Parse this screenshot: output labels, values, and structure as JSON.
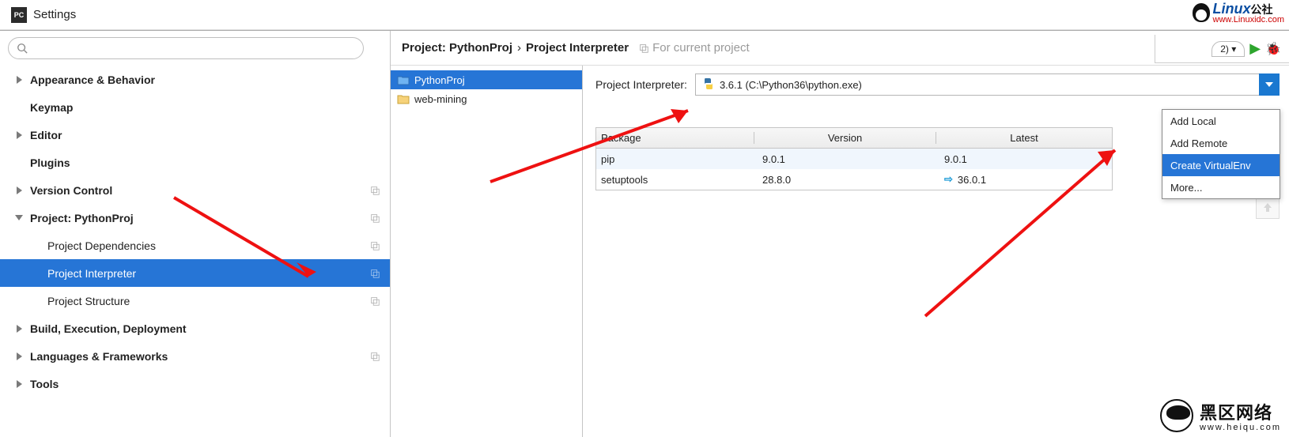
{
  "window": {
    "title": "Settings"
  },
  "search": {
    "placeholder": ""
  },
  "sidebar": {
    "items": [
      {
        "label": "Appearance & Behavior",
        "kind": "group",
        "expanded": false
      },
      {
        "label": "Keymap",
        "kind": "item"
      },
      {
        "label": "Editor",
        "kind": "group",
        "expanded": false
      },
      {
        "label": "Plugins",
        "kind": "item"
      },
      {
        "label": "Version Control",
        "kind": "group",
        "expanded": false,
        "has_scope_icon": true
      },
      {
        "label": "Project: PythonProj",
        "kind": "group",
        "expanded": true,
        "has_scope_icon": true
      },
      {
        "label": "Project Dependencies",
        "kind": "child",
        "has_scope_icon": true
      },
      {
        "label": "Project Interpreter",
        "kind": "child",
        "has_scope_icon": true,
        "selected": true
      },
      {
        "label": "Project Structure",
        "kind": "child",
        "has_scope_icon": true
      },
      {
        "label": "Build, Execution, Deployment",
        "kind": "group",
        "expanded": false
      },
      {
        "label": "Languages & Frameworks",
        "kind": "group",
        "expanded": false,
        "has_scope_icon": true
      },
      {
        "label": "Tools",
        "kind": "group",
        "expanded": false
      }
    ]
  },
  "breadcrumb": {
    "part1": "Project: PythonProj",
    "sep": "›",
    "part2": "Project Interpreter",
    "hint": "For current project"
  },
  "projects": [
    {
      "name": "PythonProj",
      "selected": true
    },
    {
      "name": "web-mining",
      "selected": false
    }
  ],
  "interpreter": {
    "label": "Project Interpreter:",
    "value": "3.6.1 (C:\\Python36\\python.exe)"
  },
  "packages": {
    "columns": [
      "Package",
      "Version",
      "Latest"
    ],
    "rows": [
      {
        "name": "pip",
        "version": "9.0.1",
        "latest": "9.0.1",
        "upgrade": false,
        "selected": true
      },
      {
        "name": "setuptools",
        "version": "28.8.0",
        "latest": "36.0.1",
        "upgrade": true,
        "selected": false
      }
    ]
  },
  "dropdown_menu": {
    "items": [
      {
        "label": "Add Local"
      },
      {
        "label": "Add Remote"
      },
      {
        "label": "Create VirtualEnv",
        "selected": true
      },
      {
        "label": "More..."
      }
    ]
  },
  "toolbar_fragment": {
    "label": "2)"
  },
  "watermarks": {
    "top_brand": "Linux",
    "top_suffix": "公社",
    "top_url": "www.Linuxidc.com",
    "bottom_brand": "黑区网络",
    "bottom_url": "www.heiqu.com"
  }
}
